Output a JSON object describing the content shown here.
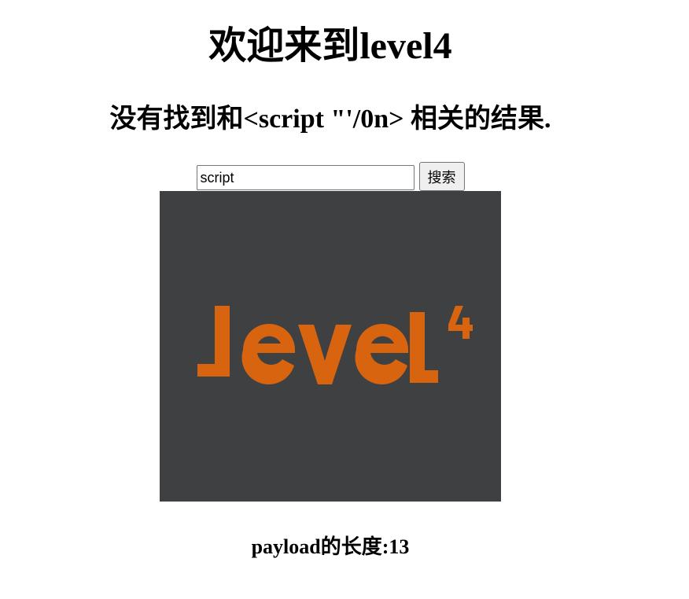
{
  "header": {
    "title": "欢迎来到level4"
  },
  "result": {
    "message": "没有找到和<script \"'/0n> 相关的结果."
  },
  "search": {
    "value": "script",
    "button_label": "搜索"
  },
  "logo": {
    "text": "level4",
    "background_color": "#3f4042",
    "text_color": "#d9640f"
  },
  "footer": {
    "payload_length": "payload的长度:13"
  }
}
